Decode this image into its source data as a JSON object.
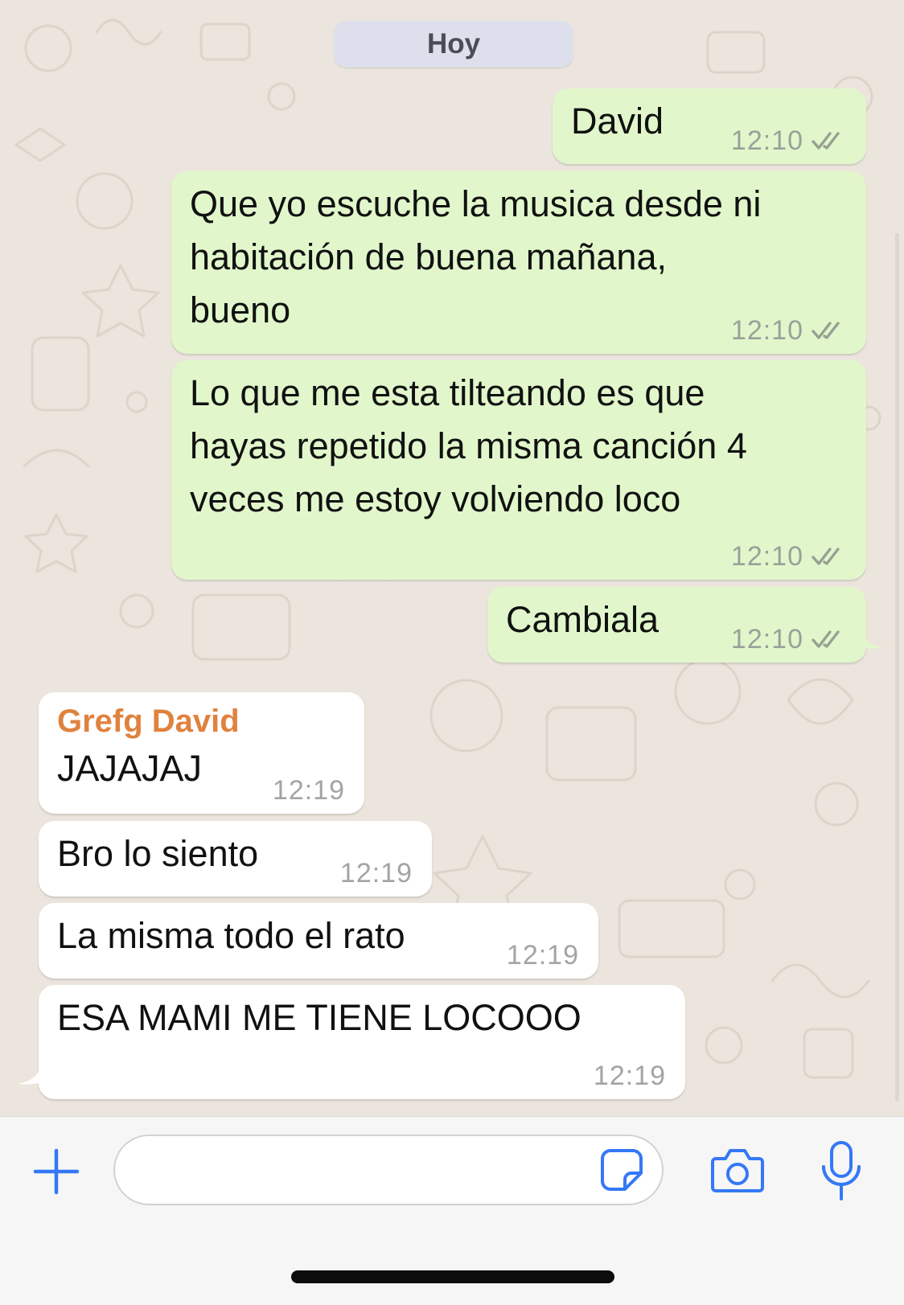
{
  "chat": {
    "date_label": "Hoy",
    "messages": [
      {
        "direction": "outgoing",
        "text": "David",
        "time": "12:10",
        "status": "read"
      },
      {
        "direction": "outgoing",
        "text": "Que yo escuche la musica desde ni\nhabitación de buena mañana,\nbueno",
        "time": "12:10",
        "status": "read"
      },
      {
        "direction": "outgoing",
        "text": "Lo que me esta tilteando es que\nhayas repetido la misma canción 4\nveces me estoy volviendo loco",
        "time": "12:10",
        "status": "read"
      },
      {
        "direction": "outgoing",
        "text": "Cambiala",
        "time": "12:10",
        "status": "read"
      },
      {
        "direction": "incoming",
        "sender": "Grefg David",
        "text": "JAJAJAJ",
        "time": "12:19"
      },
      {
        "direction": "incoming",
        "text": "Bro lo siento",
        "time": "12:19"
      },
      {
        "direction": "incoming",
        "text": "La misma todo el rato",
        "time": "12:19"
      },
      {
        "direction": "incoming",
        "text": "ESA MAMI ME TIENE LOCOOO",
        "time": "12:19"
      }
    ]
  },
  "input_bar": {
    "message_value": "",
    "icons": [
      "plus-icon",
      "sticker-icon",
      "camera-icon",
      "microphone-icon"
    ],
    "accent_color": "#3478f6"
  },
  "colors": {
    "outgoing_bubble": "#e1f7cb",
    "incoming_bubble": "#ffffff",
    "sender_name": "#e0823f",
    "read_check": "#9aa09a"
  }
}
